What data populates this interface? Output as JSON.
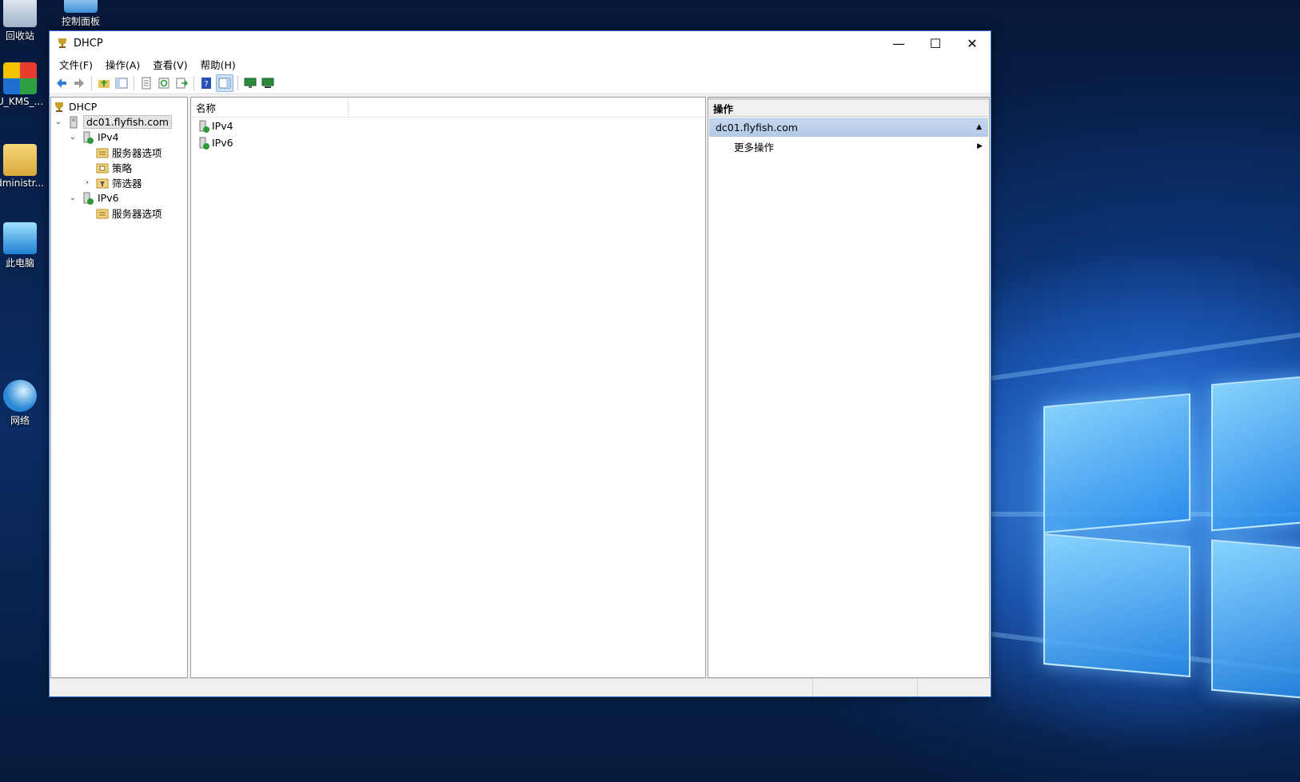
{
  "desktop": {
    "icons": [
      {
        "label": "回收站",
        "icon": "recycle-bin-icon"
      },
      {
        "label": "控制面板",
        "icon": "control-panel-icon"
      },
      {
        "label": "U_KMS_...",
        "icon": "kms-tool-icon"
      },
      {
        "label": "dministr...",
        "icon": "user-folder-icon"
      },
      {
        "label": "此电脑",
        "icon": "this-pc-icon"
      },
      {
        "label": "网络",
        "icon": "network-icon"
      }
    ]
  },
  "window": {
    "title": "DHCP",
    "controls": {
      "minimize": "—",
      "maximize": "☐",
      "close": "✕"
    }
  },
  "menu": {
    "items": [
      "文件(F)",
      "操作(A)",
      "查看(V)",
      "帮助(H)"
    ]
  },
  "toolbar": {
    "buttons": [
      "back-icon",
      "forward-icon",
      "up-folder-icon",
      "show-hide-tree-icon",
      "properties-icon",
      "refresh-icon",
      "export-list-icon",
      "help-icon",
      "show-hide-action-pane-icon",
      "monitor-icon",
      "monitor-network-icon"
    ]
  },
  "tree": {
    "root": "DHCP",
    "server": "dc01.flyfish.com",
    "ipv4": "IPv4",
    "ipv4_children": [
      "服务器选项",
      "策略",
      "筛选器"
    ],
    "ipv6": "IPv6",
    "ipv6_children": [
      "服务器选项"
    ]
  },
  "list": {
    "column_name": "名称",
    "rows": [
      "IPv4",
      "IPv6"
    ]
  },
  "actions": {
    "header": "操作",
    "group": "dc01.flyfish.com",
    "items": [
      "更多操作"
    ]
  }
}
